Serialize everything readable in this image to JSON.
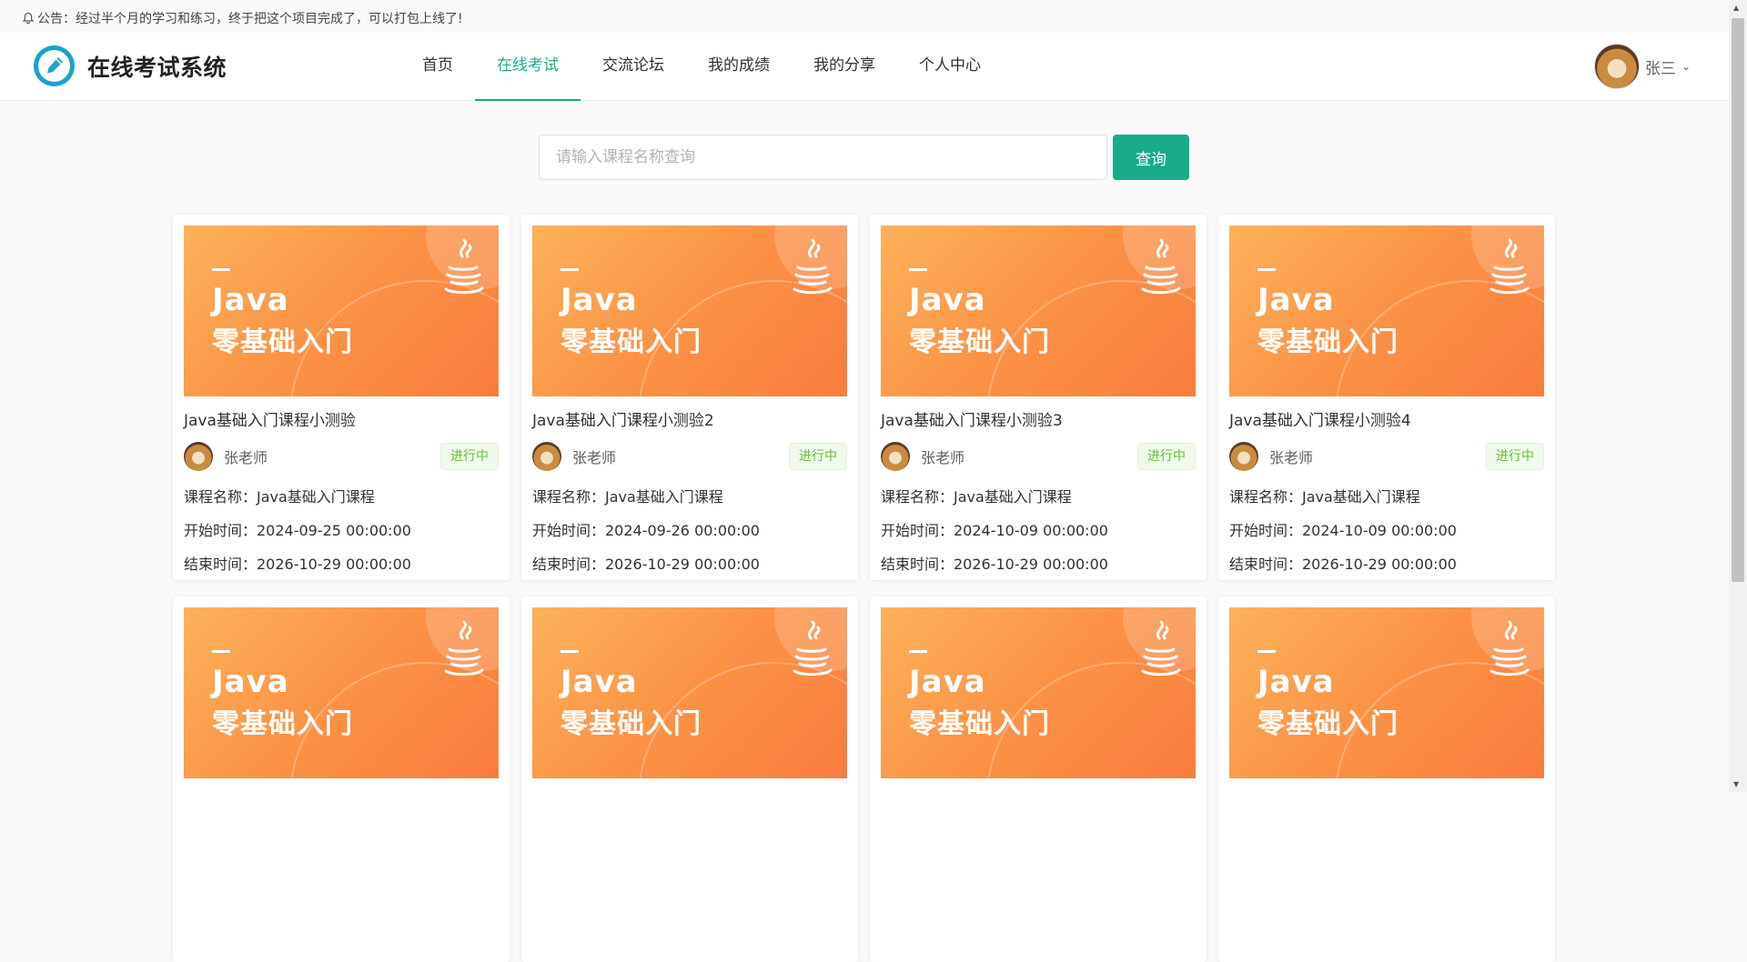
{
  "notice": {
    "text": "公告：经过半个月的学习和练习，终于把这个项目完成了，可以打包上线了!"
  },
  "logo": {
    "text": "在线考试系统"
  },
  "nav": [
    {
      "label": "首页",
      "active": false
    },
    {
      "label": "在线考试",
      "active": true
    },
    {
      "label": "交流论坛",
      "active": false
    },
    {
      "label": "我的成绩",
      "active": false
    },
    {
      "label": "我的分享",
      "active": false
    },
    {
      "label": "个人中心",
      "active": false
    }
  ],
  "user": {
    "name": "张三"
  },
  "search": {
    "placeholder": "请输入课程名称查询",
    "button": "查询"
  },
  "colors": {
    "accent": "#1aab8a",
    "status_green": "#67c23a"
  },
  "cover": {
    "line1": "Java",
    "line2": "零基础入门"
  },
  "cards": [
    {
      "title": "Java基础入门课程小测验",
      "teacher": "张老师",
      "status": "进行中",
      "course": "课程名称：Java基础入门课程",
      "start": "开始时间：2024-09-25 00:00:00",
      "end": "结束时间：2026-10-29 00:00:00"
    },
    {
      "title": "Java基础入门课程小测验2",
      "teacher": "张老师",
      "status": "进行中",
      "course": "课程名称：Java基础入门课程",
      "start": "开始时间：2024-09-26 00:00:00",
      "end": "结束时间：2026-10-29 00:00:00"
    },
    {
      "title": "Java基础入门课程小测验3",
      "teacher": "张老师",
      "status": "进行中",
      "course": "课程名称：Java基础入门课程",
      "start": "开始时间：2024-10-09 00:00:00",
      "end": "结束时间：2026-10-29 00:00:00"
    },
    {
      "title": "Java基础入门课程小测验4",
      "teacher": "张老师",
      "status": "进行中",
      "course": "课程名称：Java基础入门课程",
      "start": "开始时间：2024-10-09 00:00:00",
      "end": "结束时间：2026-10-29 00:00:00"
    },
    {
      "title": "",
      "teacher": "",
      "status": "",
      "course": "",
      "start": "",
      "end": ""
    },
    {
      "title": "",
      "teacher": "",
      "status": "",
      "course": "",
      "start": "",
      "end": ""
    },
    {
      "title": "",
      "teacher": "",
      "status": "",
      "course": "",
      "start": "",
      "end": ""
    },
    {
      "title": "",
      "teacher": "",
      "status": "",
      "course": "",
      "start": "",
      "end": ""
    }
  ]
}
